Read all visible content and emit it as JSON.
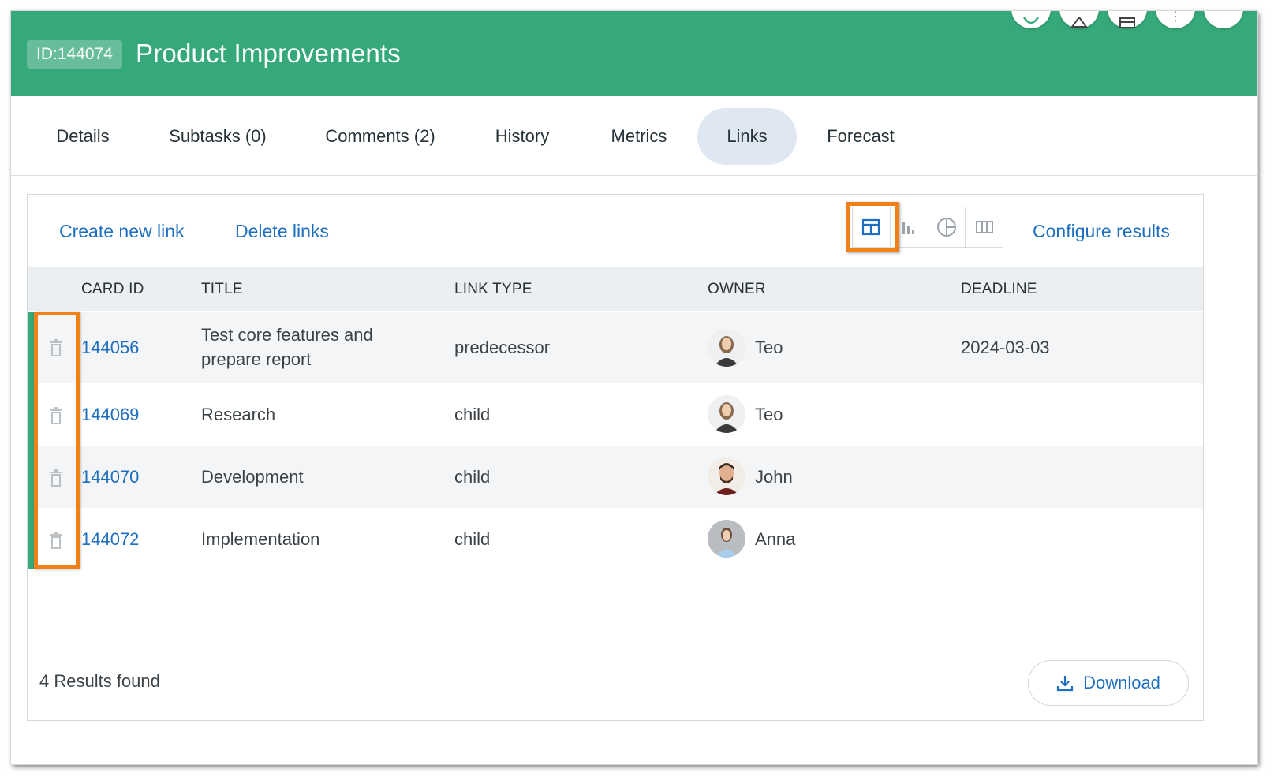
{
  "header": {
    "id_chip": "ID:144074",
    "title": "Product Improvements",
    "color": "#36a97b"
  },
  "tabs": [
    {
      "label": "Details"
    },
    {
      "label": "Subtasks (0)"
    },
    {
      "label": "Comments (2)"
    },
    {
      "label": "History"
    },
    {
      "label": "Metrics"
    },
    {
      "label": "Links",
      "active": true
    },
    {
      "label": "Forecast"
    }
  ],
  "toolbar": {
    "create_label": "Create new link",
    "delete_label": "Delete links",
    "configure_label": "Configure results",
    "views": [
      "table-view-icon",
      "bar-chart-view-icon",
      "pie-chart-view-icon",
      "columns-view-icon"
    ],
    "active_view": "table-view-icon"
  },
  "table": {
    "columns": [
      "CARD ID",
      "TITLE",
      "LINK TYPE",
      "OWNER",
      "DEADLINE"
    ],
    "rows": [
      {
        "card_id": "144056",
        "title_line1": "Test core features and",
        "title_line2": "prepare report",
        "link_type": "predecessor",
        "owner": "Teo",
        "deadline": "2024-03-03"
      },
      {
        "card_id": "144069",
        "title_line1": "Research",
        "link_type": "child",
        "owner": "Teo",
        "deadline": ""
      },
      {
        "card_id": "144070",
        "title_line1": "Development",
        "link_type": "child",
        "owner": "John",
        "deadline": ""
      },
      {
        "card_id": "144072",
        "title_line1": "Implementation",
        "link_type": "child",
        "owner": "Anna",
        "deadline": ""
      }
    ]
  },
  "footer": {
    "results": "4 Results found",
    "download_label": "Download"
  },
  "colors": {
    "accent": "#1e6fc0",
    "highlight": "#f28019",
    "active_tab": "#dfe8f2"
  }
}
